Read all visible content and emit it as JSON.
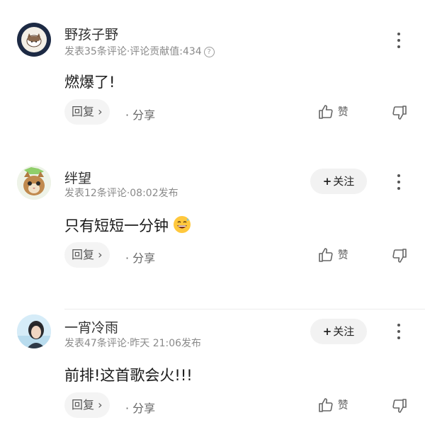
{
  "comments": [
    {
      "username": "野孩子野",
      "meta": "发表35条评论·评论贡献值:434",
      "help_icon": "?",
      "text": "燃爆了!",
      "reply_label": "回复 ›",
      "share_label": "· 分享",
      "like_label": "赞",
      "avatar": "cat-cartoon-badge"
    },
    {
      "username": "绊望",
      "meta": "发表12条评论·08:02发布",
      "follow_label": "关注",
      "follow_plus": "+",
      "text": "只有短短一分钟",
      "emoji": "grinning-sweat-emoji",
      "reply_label": "回复 ›",
      "share_label": "· 分享",
      "like_label": "赞",
      "avatar": "kitten-photo"
    },
    {
      "username": "一宵冷雨",
      "meta": "发表47条评论·昨天 21:06发布",
      "follow_label": "关注",
      "follow_plus": "+",
      "text": "前排!这首歌会火!!!",
      "reply_label": "回复 ›",
      "share_label": "· 分享",
      "like_label": "赞",
      "avatar": "person-photo"
    }
  ],
  "colors": {
    "meta_text": "#8a8a8a",
    "button_bg": "#f2f2f2",
    "divider": "#ececec"
  }
}
